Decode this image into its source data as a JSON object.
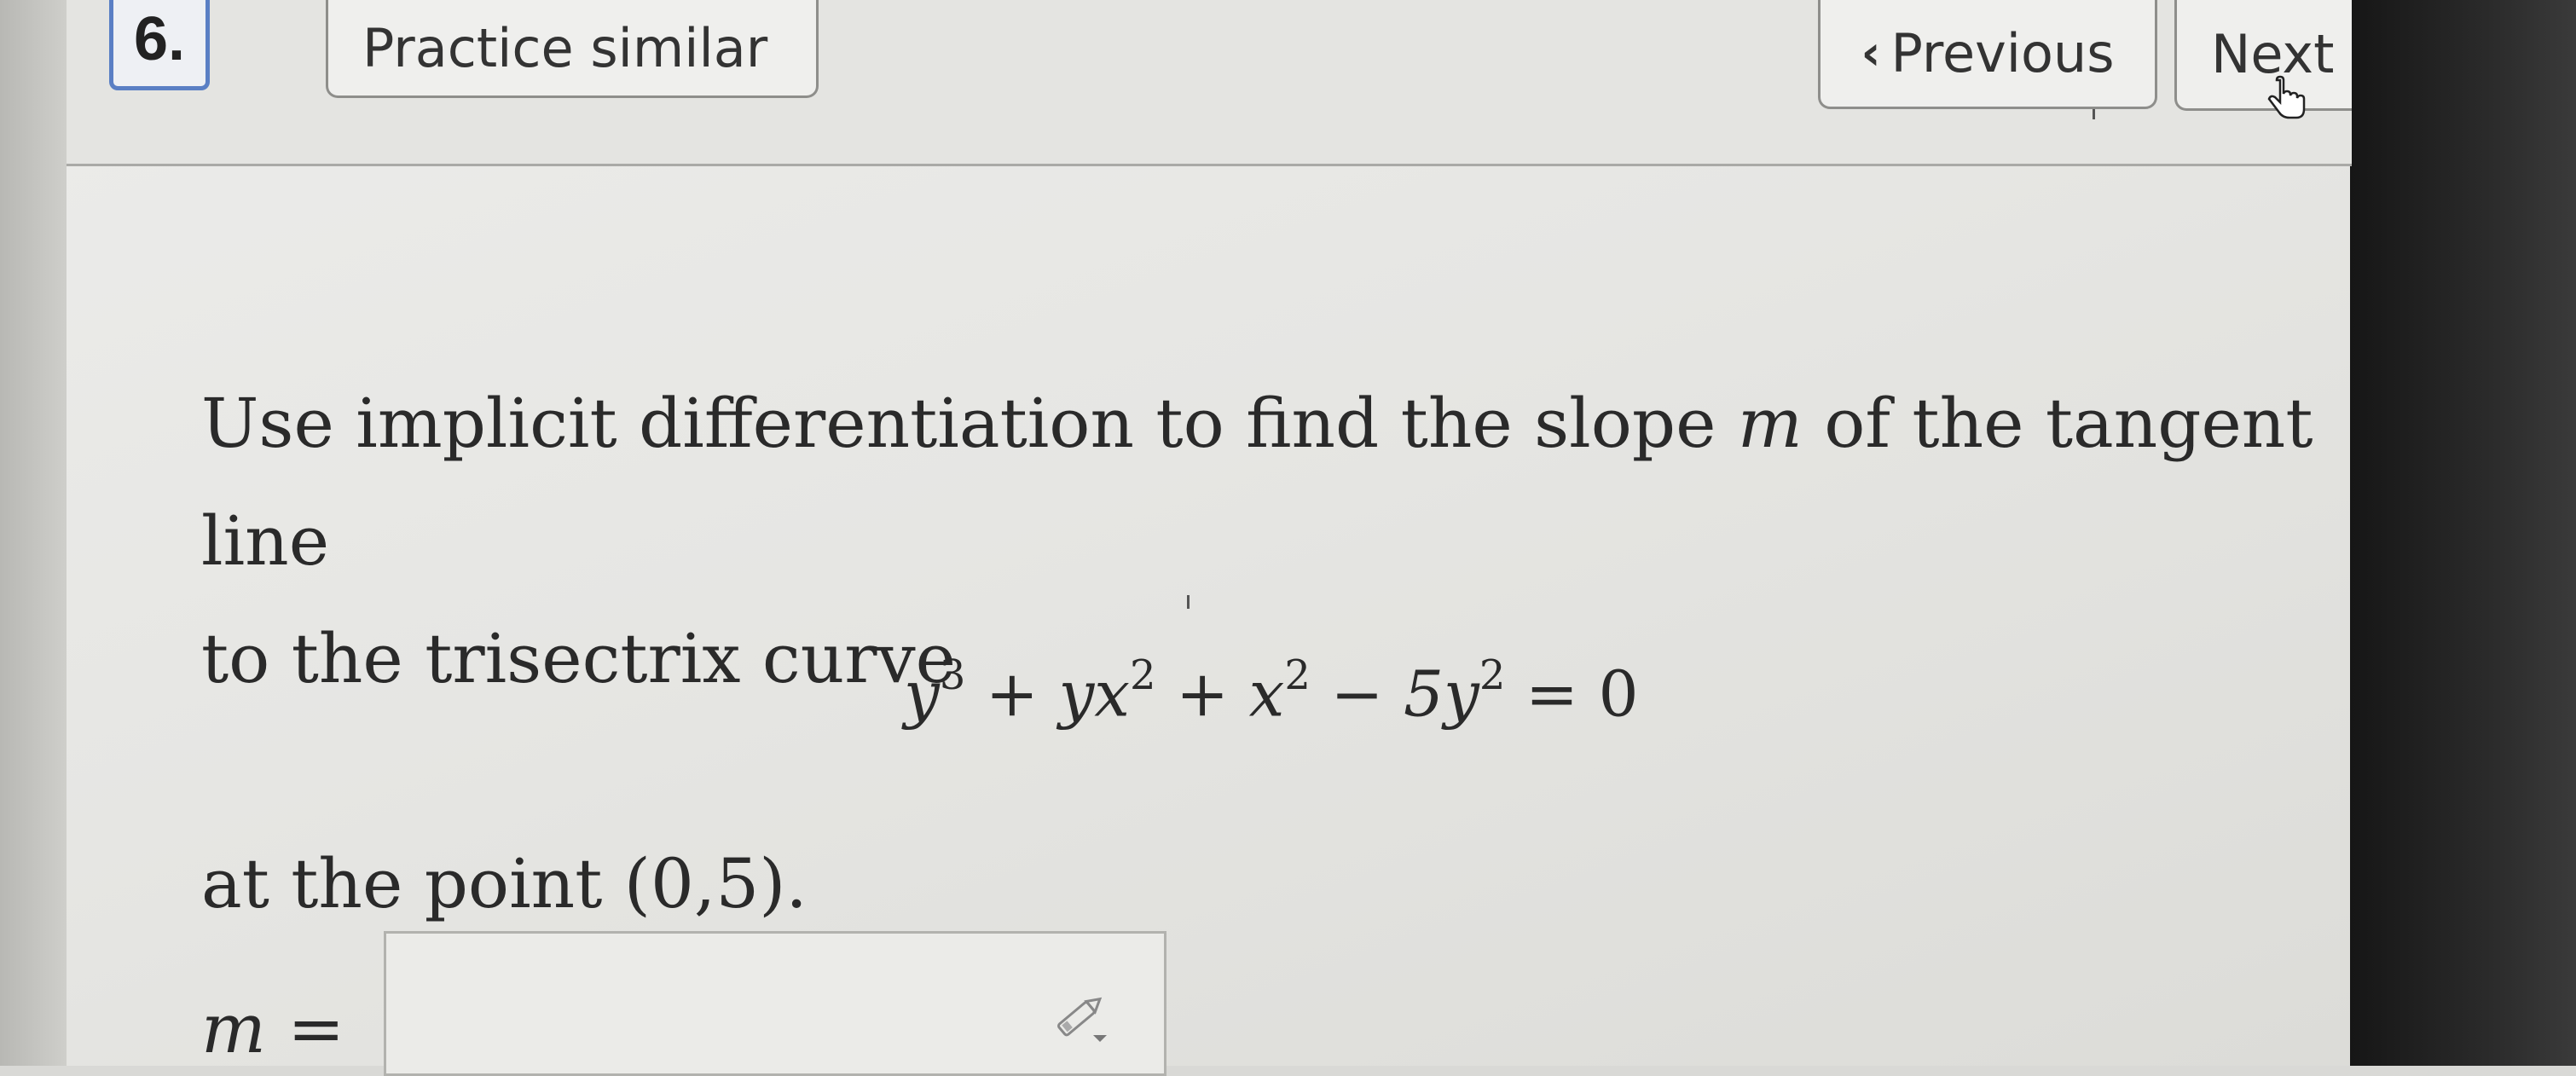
{
  "question_number": "6.",
  "toolbar": {
    "practice_label": "Practice similar",
    "previous_label": "Previous",
    "next_label": "Next"
  },
  "question": {
    "text_before_m": "Use implicit differentiation to find the slope",
    "m_symbol": "m",
    "text_after_m_line1": "of the tangent line",
    "text_line2": "to the trisectrix curve",
    "point_text": "at the point (0,5).",
    "answer_label": "m ="
  },
  "equation": {
    "term1_base": "y",
    "term1_exp": "3",
    "op1": "+",
    "term2_base": "yx",
    "term2_exp": "2",
    "op2": "+",
    "term3_base": "x",
    "term3_exp": "2",
    "op3": "−",
    "term4_base": "5y",
    "term4_exp": "2",
    "rhs": "= 0"
  },
  "answer": {
    "value": ""
  },
  "icons": [
    "chevron-left-icon",
    "pointer-hand-icon",
    "pencil-icon"
  ],
  "colors": {
    "question_number_border": "#5a7fc4",
    "page_background": "#e6e6e3",
    "text": "#2a2a2a"
  }
}
